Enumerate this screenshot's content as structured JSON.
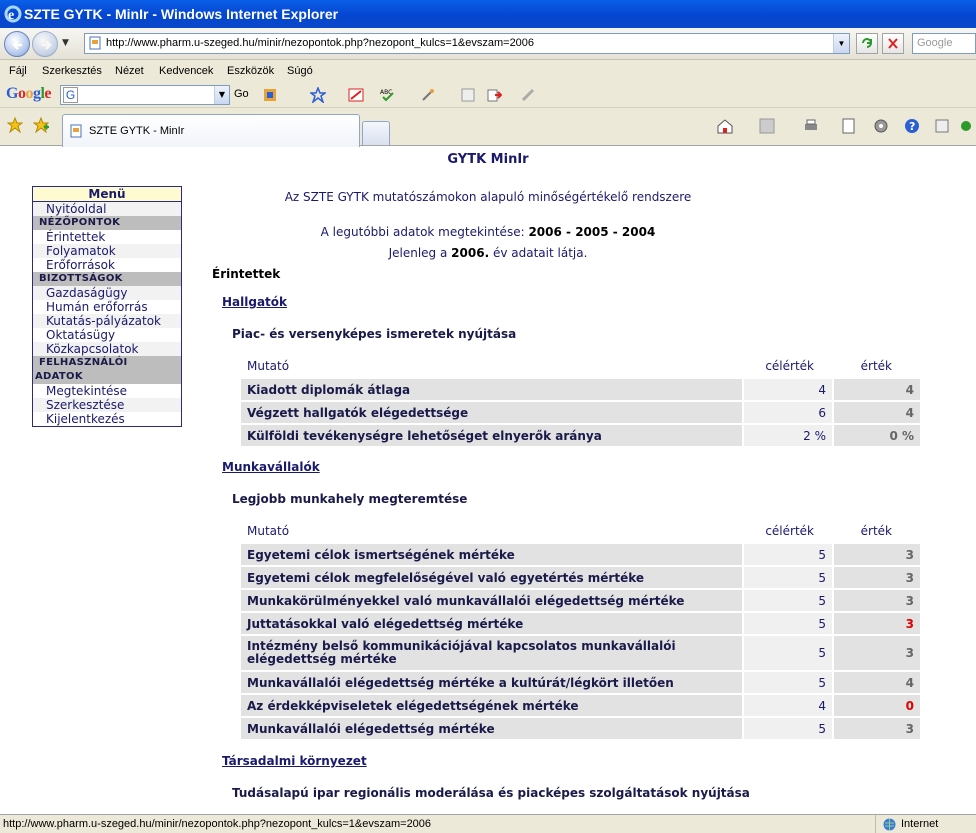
{
  "browser": {
    "window_title": "SZTE GYTK - MinIr - Windows Internet Explorer",
    "url": "http://www.pharm.u-szeged.hu/minir/nezopontok.php?nezopont_kulcs=1&evszam=2006",
    "search_placeholder": "Google",
    "menu": [
      "Fájl",
      "Szerkesztés",
      "Nézet",
      "Kedvencek",
      "Eszközök",
      "Súgó"
    ],
    "google_logo": "Google",
    "go_label": "Go",
    "tab_title": "SZTE GYTK - MinIr",
    "status_url": "http://www.pharm.u-szeged.hu/minir/nezopontok.php?nezopont_kulcs=1&evszam=2006",
    "zone": "Internet"
  },
  "page": {
    "title": "GYTK MinIr",
    "subtitle": "Az SZTE GYTK mutatószámokon alapuló minőségértékelő rendszere",
    "latest_prefix": "A legutóbbi adatok megtekintése:",
    "latest_years": "2006 - 2005 - 2004",
    "current_prefix": "Jelenleg a",
    "current_year": "2006.",
    "current_suffix": "év adatait látja.",
    "section_title": "Érintettek"
  },
  "sidebar": {
    "header": "Menü",
    "home": "Nyitóoldal",
    "sec1": "NÉZŐPONTOK",
    "sec1_items": [
      "Érintettek",
      "Folyamatok",
      "Erőforrások"
    ],
    "sec2": "BIZOTTSÁGOK",
    "sec2_items": [
      "Gazdaságügy",
      "Humán erőforrás",
      "Kutatás-pályázatok",
      "Oktatásügy",
      "Közkapcsolatok"
    ],
    "sec3_line1": "FELHASZNÁLÓI",
    "sec3_line2": "ADATOK",
    "sec3_items": [
      "Megtekintése",
      "Szerkesztése",
      "Kijelentkezés"
    ]
  },
  "columns": {
    "indicator": "Mutató",
    "target": "célérték",
    "value": "érték"
  },
  "groups": [
    {
      "name": "Hallgatók",
      "goal": "Piac- és versenyképes ismeretek nyújtása",
      "rows": [
        {
          "name": "Kiadott diplomák átlaga",
          "target": "4",
          "value": "4",
          "status": "ok"
        },
        {
          "name": "Végzett hallgatók elégedettsége",
          "target": "6",
          "value": "4",
          "status": "ok"
        },
        {
          "name": "Külföldi tevékenységre lehetőséget elnyerők aránya",
          "target": "2 %",
          "value": "0 %",
          "status": "ok"
        }
      ]
    },
    {
      "name": "Munkavállalók",
      "goal": "Legjobb munkahely megteremtése",
      "rows": [
        {
          "name": "Egyetemi célok ismertségének mértéke",
          "target": "5",
          "value": "3",
          "status": "ok"
        },
        {
          "name": "Egyetemi célok megfelelőségével való egyetértés mértéke",
          "target": "5",
          "value": "3",
          "status": "ok"
        },
        {
          "name": "Munkakörülményekkel való munkavállalói elégedettség mértéke",
          "target": "5",
          "value": "3",
          "status": "ok"
        },
        {
          "name": "Juttatásokkal való elégedettség mértéke",
          "target": "5",
          "value": "3",
          "status": "alert"
        },
        {
          "name": "Intézmény belső kommunikációjával kapcsolatos munkavállalói elégedettség mértéke",
          "target": "5",
          "value": "3",
          "status": "ok"
        },
        {
          "name": "Munkavállalói elégedettség mértéke a kultúrát/légkört illetően",
          "target": "5",
          "value": "4",
          "status": "ok"
        },
        {
          "name": "Az érdekképviseletek elégedettségének mértéke",
          "target": "4",
          "value": "0",
          "status": "alert"
        },
        {
          "name": "Munkavállalói elégedettség mértéke",
          "target": "5",
          "value": "3",
          "status": "ok"
        }
      ]
    },
    {
      "name": "Társadalmi környezet",
      "goal": "Tudásalapú ipar regionális moderálása és piacképes szolgáltatások nyújtása"
    }
  ],
  "colors": {
    "alert": "#e00000",
    "link": "#1a1a6c",
    "menu_header_bg": "#fffbd1"
  }
}
